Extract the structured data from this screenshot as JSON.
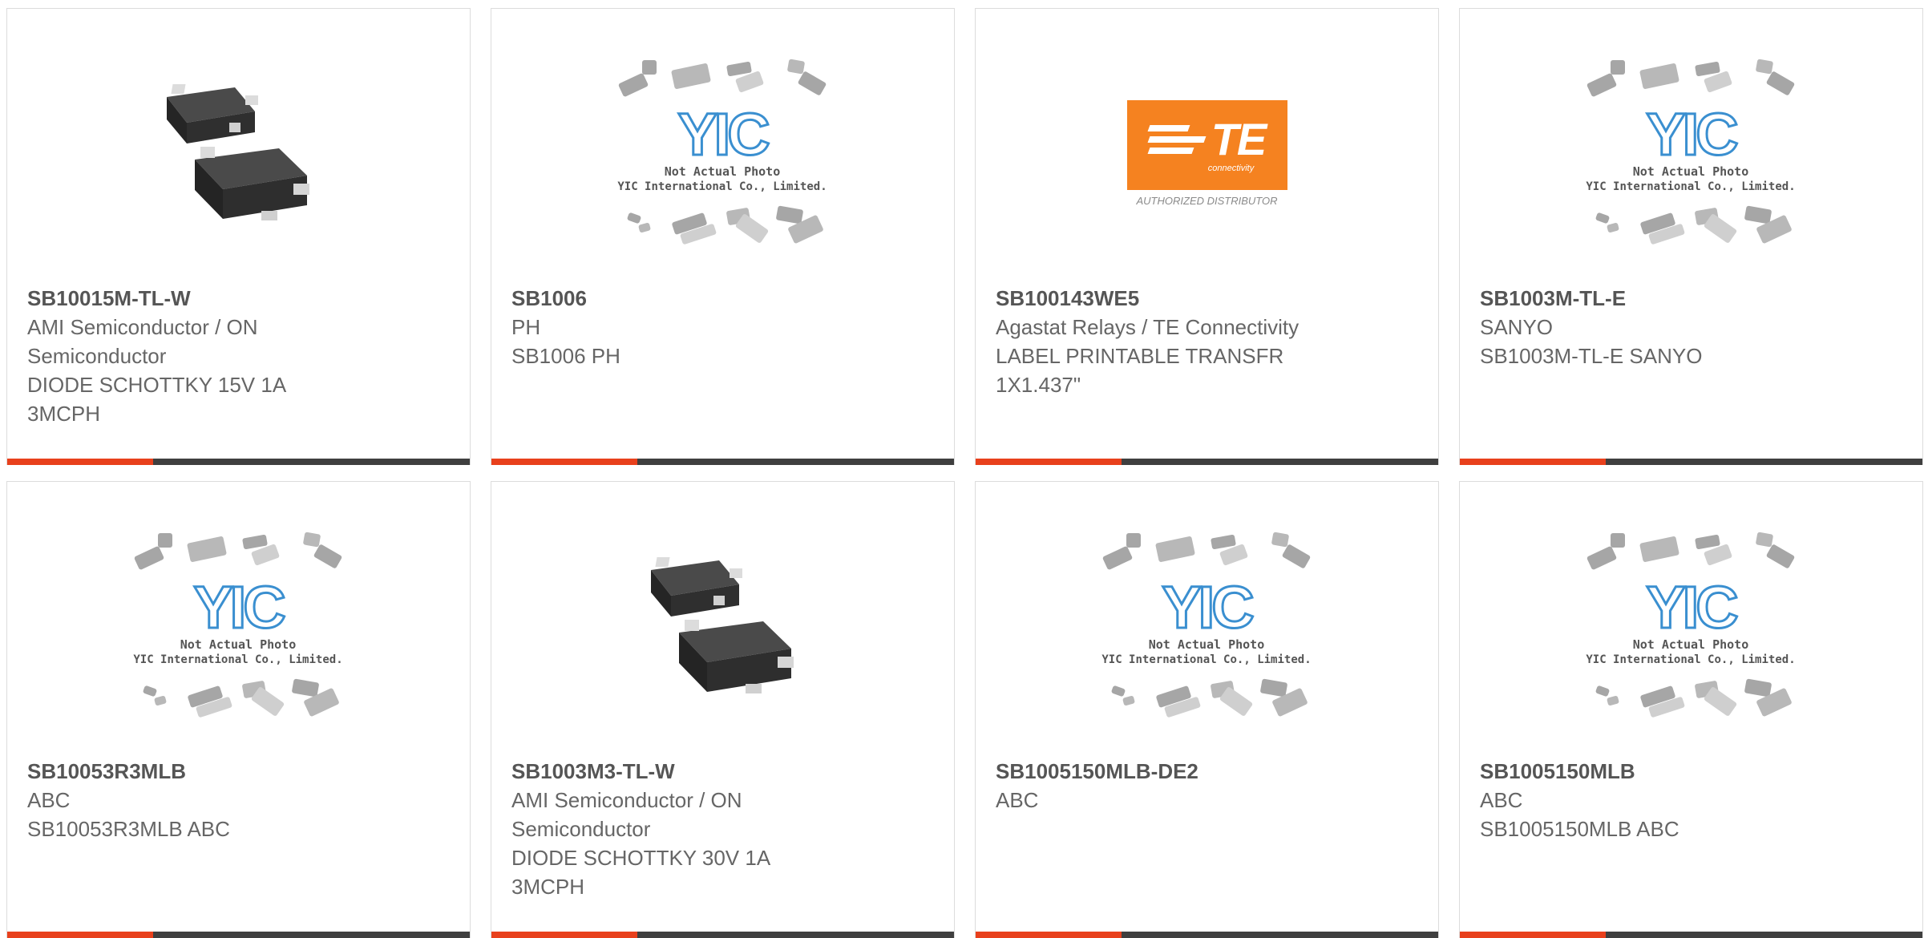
{
  "products": [
    {
      "part": "SB10015M-TL-W",
      "lines": [
        "AMI Semiconductor / ON",
        "Semiconductor",
        "DIODE SCHOTTKY 15V 1A",
        "3MCPH"
      ],
      "image": "diode-package"
    },
    {
      "part": "SB1006",
      "lines": [
        "PH",
        "SB1006 PH"
      ],
      "image": "yic-placeholder"
    },
    {
      "part": "SB100143WE5",
      "lines": [
        "Agastat Relays / TE Connectivity",
        "LABEL PRINTABLE TRANSFR",
        "1X1.437\""
      ],
      "image": "te-logo"
    },
    {
      "part": "SB1003M-TL-E",
      "lines": [
        "SANYO",
        "SB1003M-TL-E SANYO"
      ],
      "image": "yic-placeholder"
    },
    {
      "part": "SB10053R3MLB",
      "lines": [
        "ABC",
        "SB10053R3MLB ABC"
      ],
      "image": "yic-placeholder"
    },
    {
      "part": "SB1003M3-TL-W",
      "lines": [
        "AMI Semiconductor / ON",
        "Semiconductor",
        "DIODE SCHOTTKY 30V 1A",
        "3MCPH"
      ],
      "image": "diode-package"
    },
    {
      "part": "SB1005150MLB-DE2",
      "lines": [
        "ABC"
      ],
      "image": "yic-placeholder"
    },
    {
      "part": "SB1005150MLB",
      "lines": [
        "ABC",
        "SB1005150MLB ABC"
      ],
      "image": "yic-placeholder"
    }
  ],
  "placeholder": {
    "logo": "YIC",
    "caption_line1": "Not Actual Photo",
    "caption_line2": "YIC International Co., Limited."
  },
  "te": {
    "logo": "TE",
    "sub": "connectivity",
    "distributor": "AUTHORIZED DISTRIBUTOR"
  },
  "colors": {
    "accent": "#e8401c",
    "bar_dark": "#3f3f3f",
    "te_orange": "#f58220",
    "yic_blue": "#3a8fd0"
  }
}
